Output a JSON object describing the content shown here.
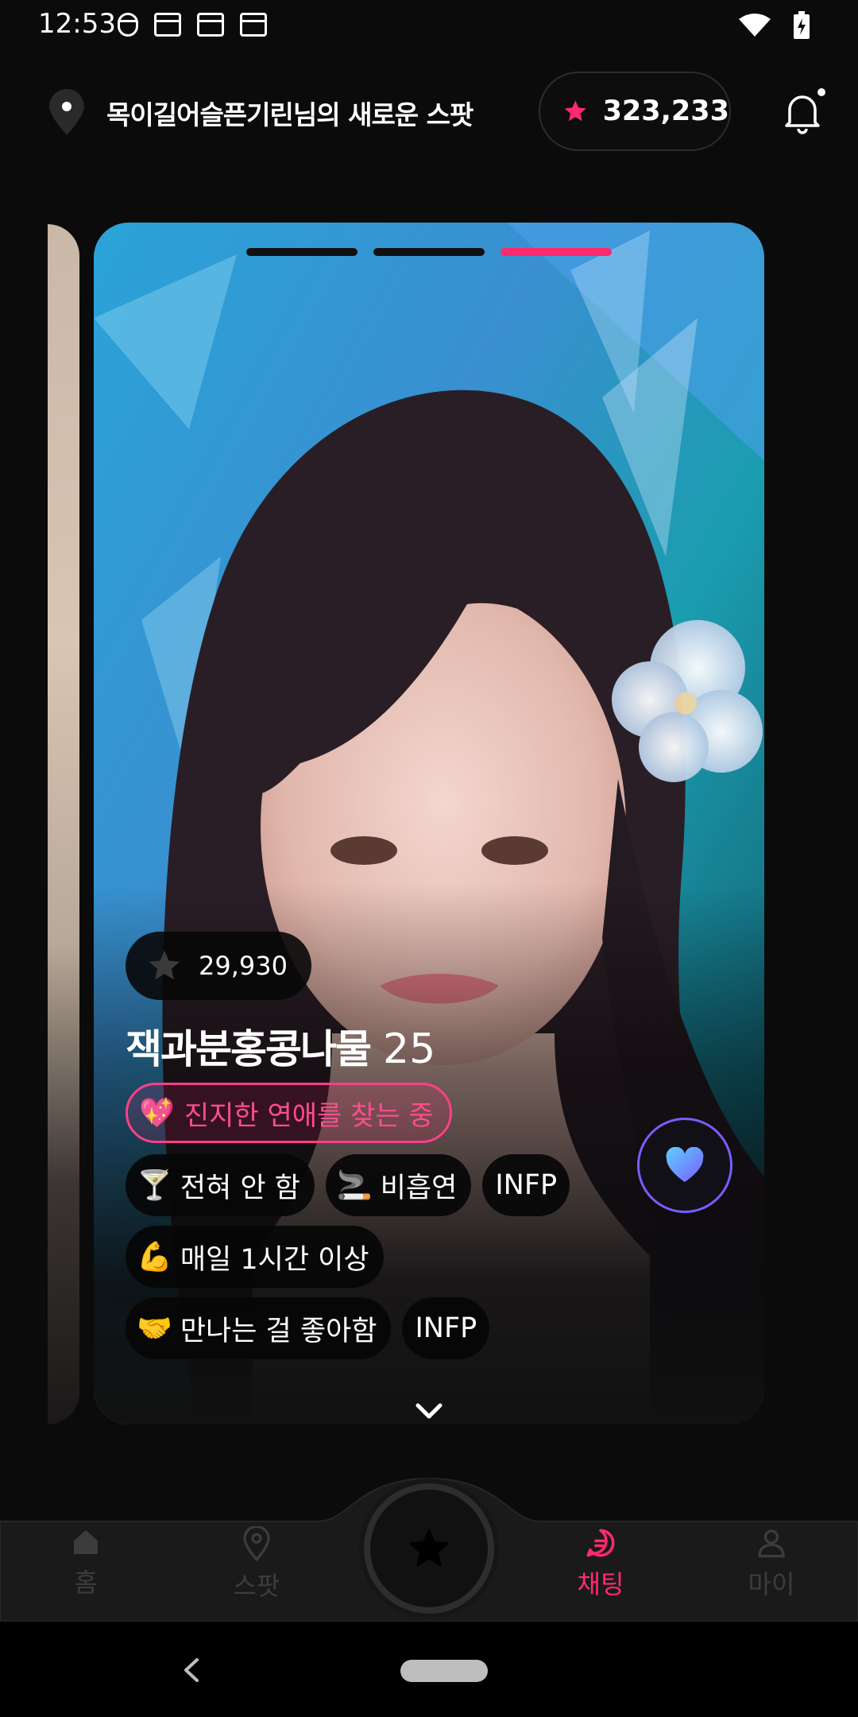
{
  "status_bar": {
    "time": "12:53",
    "left_icons": [
      "hand-icon",
      "calendar-icon",
      "calendar-icon",
      "calendar-icon"
    ],
    "right_icons": [
      "wifi-icon",
      "battery-charging-icon"
    ]
  },
  "header": {
    "location_icon": "location-pin-icon",
    "spot_title": "목이길어슬픈기린님의 새로운 스팟",
    "points_icon": "star-icon",
    "points": "323,233",
    "notification_icon": "bell-icon"
  },
  "card": {
    "progress_segments": 3,
    "active_segment": 3,
    "star_count": "29,930",
    "name": "잭과분홍콩나물",
    "age": "25",
    "intent": {
      "emoji": "💖",
      "label": "진지한 연애를 찾는 중"
    },
    "tag_rows": [
      [
        {
          "emoji": "🍸",
          "label": "전혀 안 함"
        },
        {
          "emoji": "🚬",
          "label": "비흡연"
        },
        {
          "emoji": "",
          "label": "INFP"
        }
      ],
      [
        {
          "emoji": "💪",
          "label": "매일 1시간 이상"
        }
      ],
      [
        {
          "emoji": "🤝",
          "label": "만나는 걸 좋아함"
        },
        {
          "emoji": "",
          "label": "INFP"
        }
      ]
    ],
    "like_icon": "heart-icon",
    "expand_icon": "chevron-down-icon"
  },
  "bottom_nav": {
    "items": [
      {
        "label": "홈",
        "icon": "home-icon",
        "active": false
      },
      {
        "label": "스팟",
        "icon": "location-pin-icon",
        "active": false
      },
      {
        "label": "채팅",
        "icon": "chat-icon",
        "active": true
      },
      {
        "label": "마이",
        "icon": "person-icon",
        "active": false
      }
    ],
    "center_icon": "star-icon"
  },
  "colors": {
    "accent": "#ff2a6d",
    "background": "#0b0b0b",
    "heart_border": "#7b5cff"
  }
}
